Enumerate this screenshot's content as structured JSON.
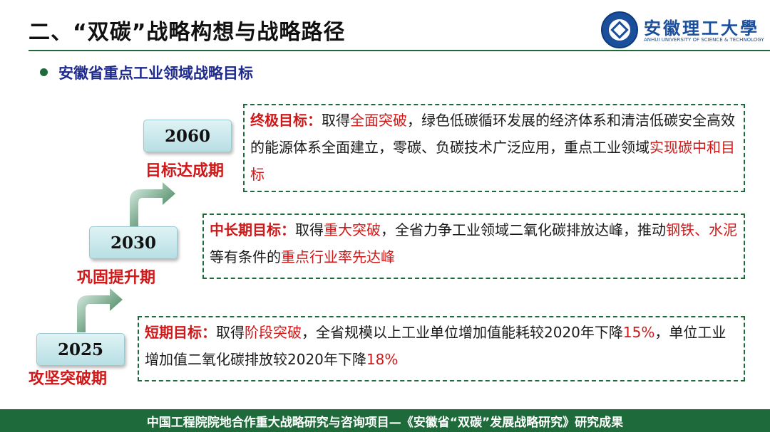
{
  "header": {
    "title": "二、“双碳”战略构想与战略路径",
    "university_name": "安徽理工大學",
    "university_name_en": "ANHUI UNIVERSITY OF SCIENCE & TECHNOLOGY",
    "rule_color": "#1f6a3a"
  },
  "section": {
    "title": "安徽省重点工业领域战略目标",
    "title_color": "#1f2b8c"
  },
  "milestones": [
    {
      "year": "2060",
      "phase": "目标达成期",
      "label": "终极目标：",
      "segments": [
        "取得",
        "全面突破",
        "，绿色低碳循环发展的经济体系和清洁低碳安全高效的能源体系全面建立，零碳、负碳技术广泛应用，重点工业领域",
        "实现碳中和目标"
      ]
    },
    {
      "year": "2030",
      "phase": "巩固提升期",
      "label": "中长期目标：",
      "segments": [
        "取得",
        "重大突破",
        "，全省力争工业领域二氧化碳排放达峰，推动",
        "钢铁、水泥",
        "等有条件的",
        "重点行业率先达峰"
      ]
    },
    {
      "year": "2025",
      "phase": "攻坚突破期",
      "label": "短期目标：",
      "segments": [
        "取得",
        "阶段突破",
        "，全省规模以上工业单位增加值能耗较2020年下降",
        "15%",
        "，单位工业增加值二氧化碳排放较2020年下降",
        "18%"
      ]
    }
  ],
  "colors": {
    "accent_red": "#d01818",
    "brand_green": "#1f6a3a",
    "year_box": "#b7dfe4"
  },
  "footer": {
    "text": "中国工程院院地合作重大战略研究与咨询项目—《安徽省“双碳”发展战略研究》研究成果"
  }
}
